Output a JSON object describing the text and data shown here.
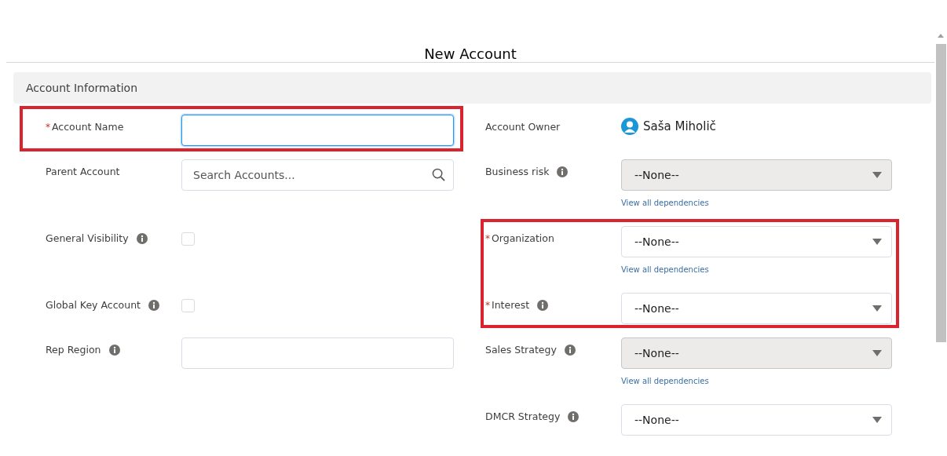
{
  "title": "New Account",
  "section": {
    "title": "Account Information"
  },
  "left_fields": [
    {
      "kind": "text",
      "label": "Account Name",
      "required_mark": "*",
      "info": false,
      "focused": true,
      "highlighted": true
    },
    {
      "kind": "lookup",
      "label": "Parent Account",
      "info": false,
      "placeholder": "Search Accounts...",
      "highlighted": false
    },
    {
      "kind": "checkbox",
      "label": "General Visibility",
      "info": true,
      "checked": false,
      "highlighted": false
    },
    {
      "kind": "checkbox",
      "label": "Global Key Account",
      "info": true,
      "checked": false,
      "highlighted": false
    },
    {
      "kind": "text",
      "label": "Rep Region",
      "info": true,
      "focused": false,
      "highlighted": false
    }
  ],
  "right_fields": [
    {
      "kind": "owner",
      "label": "Account Owner",
      "info": false,
      "value": "Saša Miholič",
      "highlighted": false
    },
    {
      "kind": "select",
      "label": "Business risk",
      "info": true,
      "value": "--None--",
      "disabled": true,
      "link": "View all dependencies",
      "highlighted": false
    },
    {
      "kind": "select",
      "label": "Organization",
      "required_mark": "*",
      "info": false,
      "value": "--None--",
      "disabled": false,
      "link": "View all dependencies",
      "highlighted": true
    },
    {
      "kind": "select",
      "label": "Interest",
      "required_mark": "*",
      "info": true,
      "value": "--None--",
      "disabled": false,
      "highlighted": true
    },
    {
      "kind": "select",
      "label": "Sales Strategy",
      "info": true,
      "value": "--None--",
      "disabled": true,
      "link": "View all dependencies",
      "highlighted": false
    },
    {
      "kind": "select",
      "label": "DMCR Strategy",
      "info": true,
      "value": "--None--",
      "disabled": false,
      "highlighted": false
    }
  ]
}
